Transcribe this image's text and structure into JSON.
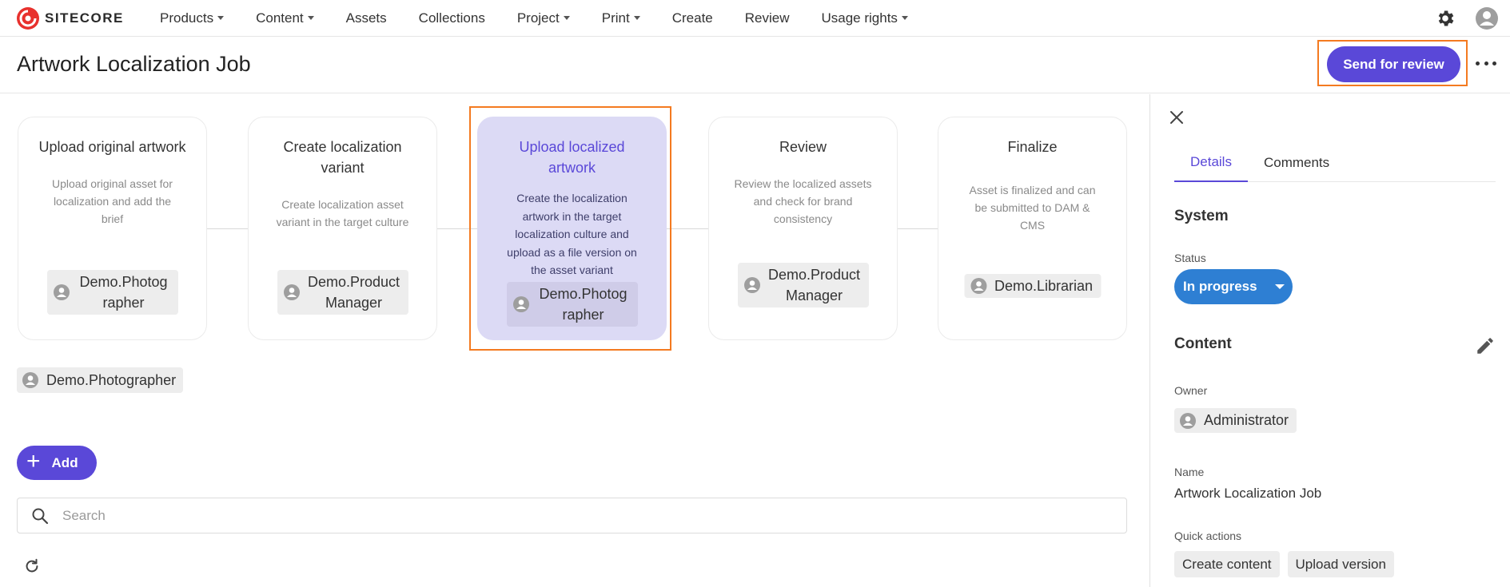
{
  "brand": {
    "name": "SITECORE",
    "accent": "#e8312d"
  },
  "nav": {
    "items": [
      {
        "label": "Products",
        "dropdown": true
      },
      {
        "label": "Content",
        "dropdown": true
      },
      {
        "label": "Assets",
        "dropdown": false
      },
      {
        "label": "Collections",
        "dropdown": false
      },
      {
        "label": "Project",
        "dropdown": true
      },
      {
        "label": "Print",
        "dropdown": true
      },
      {
        "label": "Create",
        "dropdown": false
      },
      {
        "label": "Review",
        "dropdown": false
      },
      {
        "label": "Usage rights",
        "dropdown": true
      }
    ],
    "icons": [
      "gear-icon",
      "user-avatar-icon"
    ]
  },
  "header": {
    "title": "Artwork Localization Job",
    "primary_action": "Send for review",
    "more_icon": "more-horizontal-icon"
  },
  "workflow": {
    "steps": [
      {
        "title": "Upload original artwork",
        "description": "Upload original asset for localization and add the brief",
        "assignee": "Demo.Photographer",
        "active": false
      },
      {
        "title": "Create localization variant",
        "description": "Create localization asset variant in the target culture",
        "assignee": "Demo.Product Manager",
        "active": false
      },
      {
        "title": "Upload localized artwork",
        "description": "Create the localization artwork in the target localization culture and upload as a file version on the asset variant",
        "assignee": "Demo.Photographer",
        "active": true
      },
      {
        "title": "Review",
        "description": "Review the localized assets and check for brand consistency",
        "assignee": "Demo.Product Manager",
        "active": false
      },
      {
        "title": "Finalize",
        "description": "Asset is finalized and can be submitted to DAM & CMS",
        "assignee": "Demo.Librarian",
        "active": false
      }
    ],
    "current_assignee": "Demo.Photographer"
  },
  "actions": {
    "add_label": "Add"
  },
  "search": {
    "placeholder": "Search",
    "value": ""
  },
  "panel": {
    "tabs": [
      {
        "label": "Details",
        "active": true
      },
      {
        "label": "Comments",
        "active": false
      }
    ],
    "system": {
      "title": "System",
      "status_label": "Status",
      "status_value": "In progress",
      "status_color": "#2e7fd3"
    },
    "content": {
      "title": "Content",
      "owner_label": "Owner",
      "owner_value": "Administrator",
      "name_label": "Name",
      "name_value": "Artwork Localization Job",
      "quick_actions_label": "Quick actions",
      "quick_actions": [
        "Create content",
        "Upload version"
      ]
    }
  },
  "colors": {
    "primary": "#5a48d8",
    "highlight": "#f47a20",
    "active_step_bg": "#dcdaf5"
  }
}
